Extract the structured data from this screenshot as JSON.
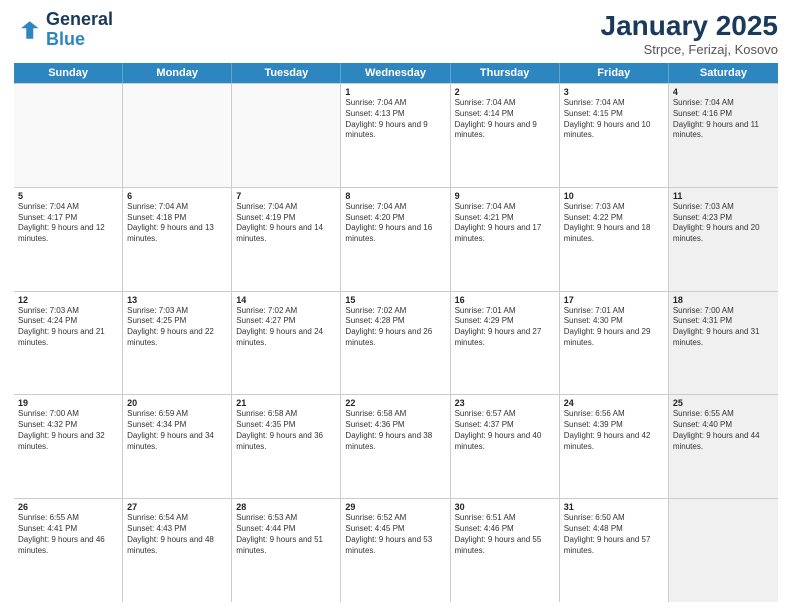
{
  "logo": {
    "line1": "General",
    "line2": "Blue"
  },
  "title": "January 2025",
  "location": "Strpce, Ferizaj, Kosovo",
  "days_of_week": [
    "Sunday",
    "Monday",
    "Tuesday",
    "Wednesday",
    "Thursday",
    "Friday",
    "Saturday"
  ],
  "weeks": [
    [
      {
        "day": "",
        "empty": true
      },
      {
        "day": "",
        "empty": true
      },
      {
        "day": "",
        "empty": true
      },
      {
        "day": "1",
        "sunrise": "7:04 AM",
        "sunset": "4:13 PM",
        "daylight": "9 hours and 9 minutes."
      },
      {
        "day": "2",
        "sunrise": "7:04 AM",
        "sunset": "4:14 PM",
        "daylight": "9 hours and 9 minutes."
      },
      {
        "day": "3",
        "sunrise": "7:04 AM",
        "sunset": "4:15 PM",
        "daylight": "9 hours and 10 minutes."
      },
      {
        "day": "4",
        "sunrise": "7:04 AM",
        "sunset": "4:16 PM",
        "daylight": "9 hours and 11 minutes.",
        "shaded": true
      }
    ],
    [
      {
        "day": "5",
        "sunrise": "7:04 AM",
        "sunset": "4:17 PM",
        "daylight": "9 hours and 12 minutes."
      },
      {
        "day": "6",
        "sunrise": "7:04 AM",
        "sunset": "4:18 PM",
        "daylight": "9 hours and 13 minutes."
      },
      {
        "day": "7",
        "sunrise": "7:04 AM",
        "sunset": "4:19 PM",
        "daylight": "9 hours and 14 minutes."
      },
      {
        "day": "8",
        "sunrise": "7:04 AM",
        "sunset": "4:20 PM",
        "daylight": "9 hours and 16 minutes."
      },
      {
        "day": "9",
        "sunrise": "7:04 AM",
        "sunset": "4:21 PM",
        "daylight": "9 hours and 17 minutes."
      },
      {
        "day": "10",
        "sunrise": "7:03 AM",
        "sunset": "4:22 PM",
        "daylight": "9 hours and 18 minutes."
      },
      {
        "day": "11",
        "sunrise": "7:03 AM",
        "sunset": "4:23 PM",
        "daylight": "9 hours and 20 minutes.",
        "shaded": true
      }
    ],
    [
      {
        "day": "12",
        "sunrise": "7:03 AM",
        "sunset": "4:24 PM",
        "daylight": "9 hours and 21 minutes."
      },
      {
        "day": "13",
        "sunrise": "7:03 AM",
        "sunset": "4:25 PM",
        "daylight": "9 hours and 22 minutes."
      },
      {
        "day": "14",
        "sunrise": "7:02 AM",
        "sunset": "4:27 PM",
        "daylight": "9 hours and 24 minutes."
      },
      {
        "day": "15",
        "sunrise": "7:02 AM",
        "sunset": "4:28 PM",
        "daylight": "9 hours and 26 minutes."
      },
      {
        "day": "16",
        "sunrise": "7:01 AM",
        "sunset": "4:29 PM",
        "daylight": "9 hours and 27 minutes."
      },
      {
        "day": "17",
        "sunrise": "7:01 AM",
        "sunset": "4:30 PM",
        "daylight": "9 hours and 29 minutes."
      },
      {
        "day": "18",
        "sunrise": "7:00 AM",
        "sunset": "4:31 PM",
        "daylight": "9 hours and 31 minutes.",
        "shaded": true
      }
    ],
    [
      {
        "day": "19",
        "sunrise": "7:00 AM",
        "sunset": "4:32 PM",
        "daylight": "9 hours and 32 minutes."
      },
      {
        "day": "20",
        "sunrise": "6:59 AM",
        "sunset": "4:34 PM",
        "daylight": "9 hours and 34 minutes."
      },
      {
        "day": "21",
        "sunrise": "6:58 AM",
        "sunset": "4:35 PM",
        "daylight": "9 hours and 36 minutes."
      },
      {
        "day": "22",
        "sunrise": "6:58 AM",
        "sunset": "4:36 PM",
        "daylight": "9 hours and 38 minutes."
      },
      {
        "day": "23",
        "sunrise": "6:57 AM",
        "sunset": "4:37 PM",
        "daylight": "9 hours and 40 minutes."
      },
      {
        "day": "24",
        "sunrise": "6:56 AM",
        "sunset": "4:39 PM",
        "daylight": "9 hours and 42 minutes."
      },
      {
        "day": "25",
        "sunrise": "6:55 AM",
        "sunset": "4:40 PM",
        "daylight": "9 hours and 44 minutes.",
        "shaded": true
      }
    ],
    [
      {
        "day": "26",
        "sunrise": "6:55 AM",
        "sunset": "4:41 PM",
        "daylight": "9 hours and 46 minutes."
      },
      {
        "day": "27",
        "sunrise": "6:54 AM",
        "sunset": "4:43 PM",
        "daylight": "9 hours and 48 minutes."
      },
      {
        "day": "28",
        "sunrise": "6:53 AM",
        "sunset": "4:44 PM",
        "daylight": "9 hours and 51 minutes."
      },
      {
        "day": "29",
        "sunrise": "6:52 AM",
        "sunset": "4:45 PM",
        "daylight": "9 hours and 53 minutes."
      },
      {
        "day": "30",
        "sunrise": "6:51 AM",
        "sunset": "4:46 PM",
        "daylight": "9 hours and 55 minutes."
      },
      {
        "day": "31",
        "sunrise": "6:50 AM",
        "sunset": "4:48 PM",
        "daylight": "9 hours and 57 minutes."
      },
      {
        "day": "",
        "empty": true,
        "shaded": true
      }
    ]
  ]
}
